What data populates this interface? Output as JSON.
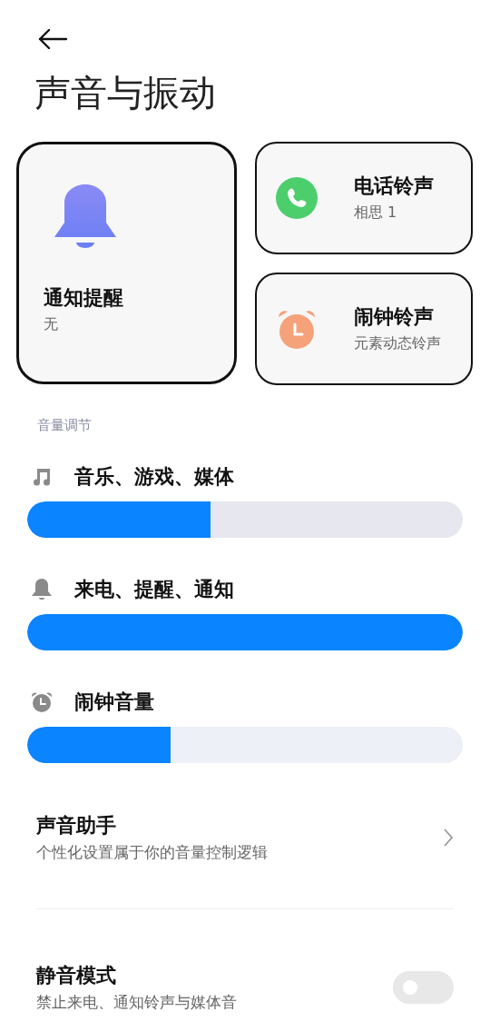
{
  "title": "声音与振动",
  "cards": [
    {
      "kind": "notification",
      "title": "通知提醒",
      "subtitle": "无"
    },
    {
      "kind": "phone",
      "title": "电话铃声",
      "subtitle": "相思 1"
    },
    {
      "kind": "alarm",
      "title": "闹钟铃声",
      "subtitle": "元素动态铃声"
    }
  ],
  "section_label": "音量调节",
  "volumes": [
    {
      "kind": "music",
      "label": "音乐、游戏、媒体",
      "level": 0.42
    },
    {
      "kind": "ring",
      "label": "来电、提醒、通知",
      "level": 1.0
    },
    {
      "kind": "alarm",
      "label": "闹钟音量",
      "level": 0.33
    }
  ],
  "settings": [
    {
      "kind": "link",
      "title": "声音助手",
      "subtitle": "个性化设置属于你的音量控制逻辑"
    },
    {
      "kind": "toggle",
      "title": "静音模式",
      "subtitle": "禁止来电、通知铃声与媒体音",
      "on": false
    }
  ]
}
